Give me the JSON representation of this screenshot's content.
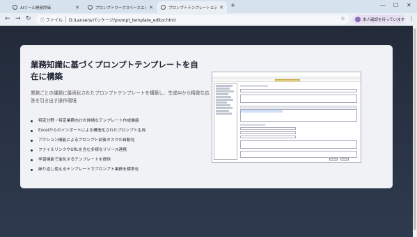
{
  "browser": {
    "tabs": [
      {
        "title": "AIツール開発評価",
        "active": false
      },
      {
        "title": "プロンプトワークスペースエディタ - A…",
        "active": false
      },
      {
        "title": "プロンプトテンプレートエディタ 紹介",
        "active": true
      }
    ],
    "new_tab": "+",
    "controls": {
      "minimize": "—",
      "maximize": "☐",
      "close": "✕"
    },
    "nav": {
      "back": "←",
      "forward": "→",
      "reload": "↻"
    },
    "security_label": "ファイル",
    "url": "D:/Lansers/パッケージ/prompt_template_editor.html",
    "profile_label": "本人確認を待っています"
  },
  "card": {
    "title": "業務知識に基づくプロンプトテンプレートを自在に構築",
    "description": "業務ごとの課題に最適化されたプロンプトテンプレートを構築し、生成AIから精緻な応答を引き出す操作環境",
    "features": [
      "特定分野・特定業務向けの詳細なテンプレート作成機能",
      "Excelからのインポートによる構造化されたプロンプト生成",
      "アクション機能によるプロンプト前後タスクの自動化",
      "ファイルリンクやURLを含む多様なリソース連携",
      "学習機能で進化するテンプレートを提供",
      "繰り返し使えるテンプレートでプロンプト業務を標準化"
    ]
  }
}
